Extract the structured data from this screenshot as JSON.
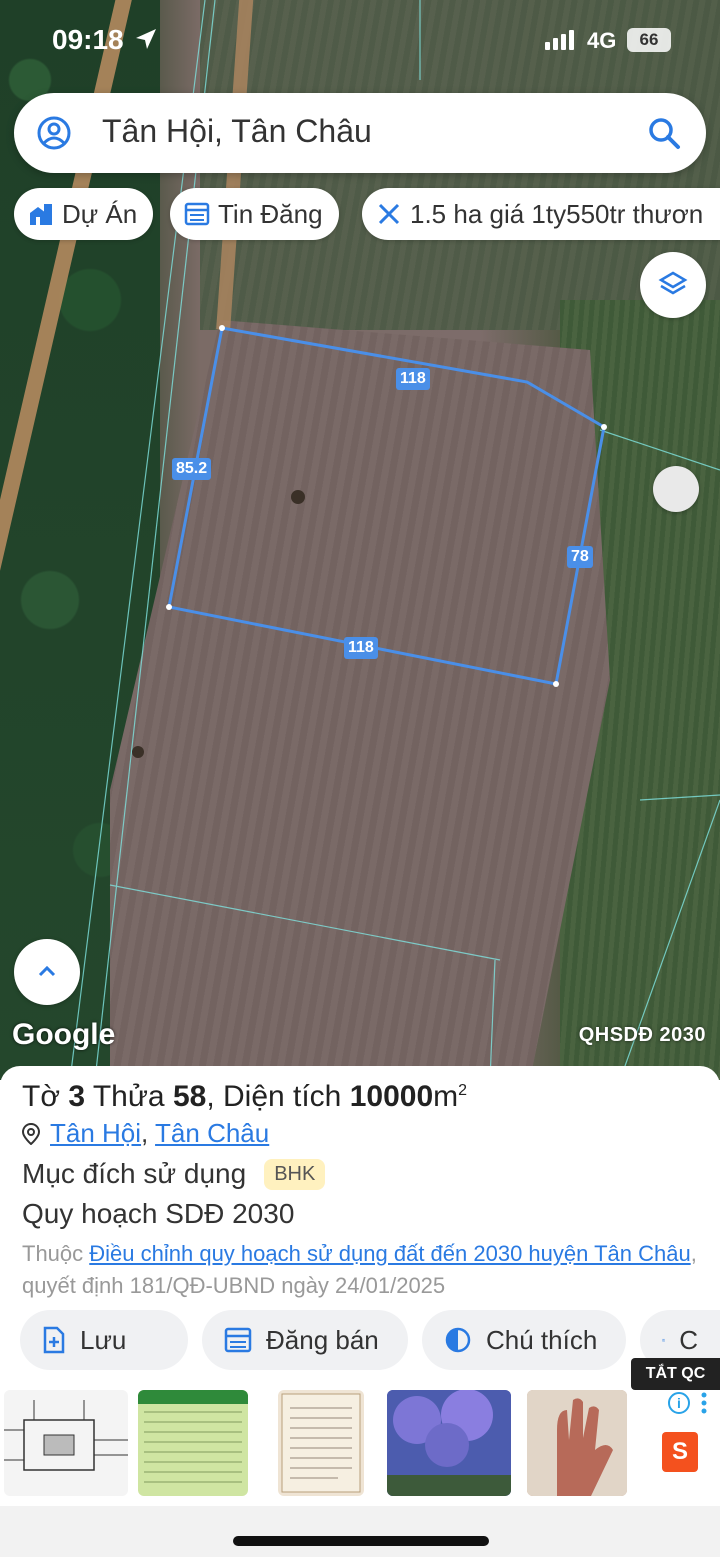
{
  "status_bar": {
    "time": "09:18",
    "network": "4G",
    "battery": "66"
  },
  "search": {
    "query": "Tân Hội, Tân Châu"
  },
  "chips": {
    "du_an": "Dự Án",
    "tin_dang": "Tin Đăng",
    "listing": "1.5 ha giá 1ty550tr thươn"
  },
  "map": {
    "dimensions": {
      "top": "118",
      "left": "85.2",
      "right": "78",
      "bottom": "118"
    },
    "google": "Google",
    "layer_name": "QHSDĐ 2030",
    "boundary_color": "#4a8fe8"
  },
  "parcel": {
    "title_prefix": "Tờ ",
    "sheet": "3",
    "title_mid": " Thửa ",
    "plot": "58",
    "title_area_label": ", Diện tích ",
    "area": "10000",
    "unit": "m",
    "unit_sup": "2",
    "location": {
      "commune": "Tân Hội",
      "separator": ",",
      "district": "Tân Châu"
    },
    "purpose_label": "Mục đích sử dụng",
    "purpose_code": "BHK",
    "plan_label": "Quy hoạch SDĐ 2030",
    "belongs_prefix": "Thuộc ",
    "belongs_link": "Điều chỉnh quy hoạch sử dụng đất đến 2030 huyện Tân Châu",
    "belongs_suffix": ", quyết định 181/QĐ-UBND ngày 24/01/2025"
  },
  "actions": {
    "save": "Lưu",
    "sell": "Đăng bán",
    "legend": "Chú thích",
    "camera_partial": "C"
  },
  "ads": {
    "label": "TẮT QC",
    "info": "i",
    "shop": "S"
  }
}
